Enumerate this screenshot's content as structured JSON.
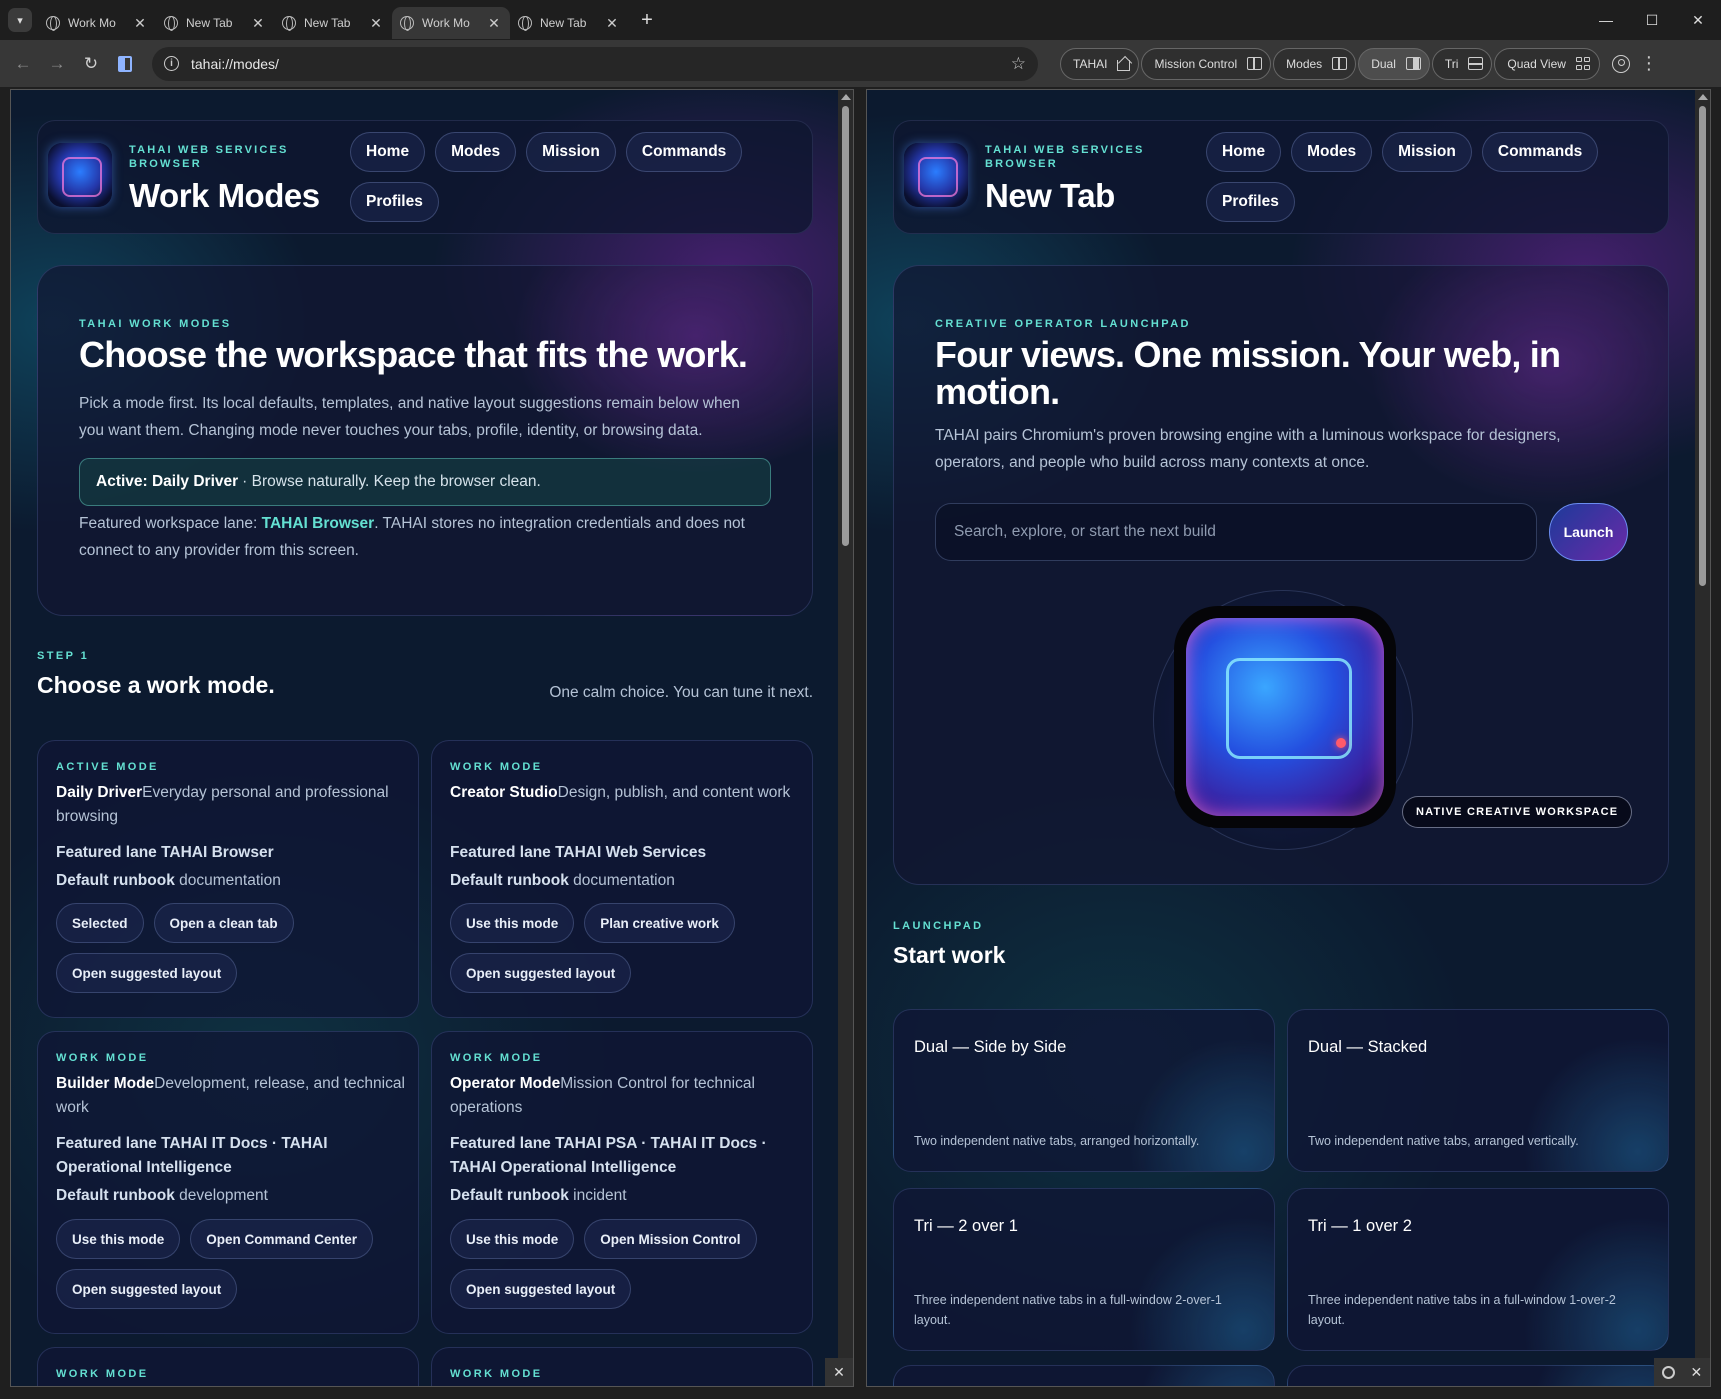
{
  "browser": {
    "tabs": [
      {
        "title": "Work Mo",
        "active": false
      },
      {
        "title": "New Tab",
        "active": false
      },
      {
        "title": "New Tab",
        "active": false
      },
      {
        "title": "Work Mo",
        "active": true
      },
      {
        "title": "New Tab",
        "active": false
      }
    ],
    "url": "tahai://modes/",
    "view_buttons": [
      {
        "label": "TAHAI",
        "icon": "home-icon"
      },
      {
        "label": "Mission Control",
        "icon": "grid-layout-icon"
      },
      {
        "label": "Modes",
        "icon": "grid-layout-icon"
      },
      {
        "label": "Dual",
        "icon": "split-view-icon",
        "active": true
      },
      {
        "label": "Tri",
        "icon": "tri-view-icon"
      },
      {
        "label": "Quad View",
        "icon": "quad-view-icon"
      }
    ]
  },
  "header": {
    "brand_sub": "TAHAI WEB SERVICES BROWSER",
    "nav": [
      "Home",
      "Modes",
      "Mission",
      "Commands",
      "Profiles"
    ]
  },
  "left": {
    "page_title": "Work Modes",
    "hero": {
      "eyebrow": "TAHAI WORK MODES",
      "title": "Choose the workspace that fits the work.",
      "description": "Pick a mode first. Its local defaults, templates, and native layout suggestions remain below when you want them. Changing mode never touches your tabs, profile, identity, or browsing data.",
      "active_label": "Active: Daily Driver",
      "active_text": "· Browse naturally. Keep the browser clean.",
      "featured_prefix": "Featured workspace lane: ",
      "featured_lane": "TAHAI Browser",
      "featured_suffix": ". TAHAI stores no integration credentials and does not connect to any provider from this screen."
    },
    "step": {
      "eyebrow": "STEP 1",
      "title": "Choose a work mode.",
      "note": "One calm choice. You can tune it next."
    },
    "modes": [
      {
        "eyebrow": "ACTIVE MODE",
        "name": "Daily Driver",
        "desc": "Everyday personal and professional browsing",
        "lane": "Featured lane TAHAI Browser",
        "runbook_label": "Default runbook",
        "runbook": "documentation",
        "buttons": [
          "Selected",
          "Open a clean tab",
          "Open suggested layout"
        ]
      },
      {
        "eyebrow": "WORK MODE",
        "name": "Creator Studio",
        "desc": "Design, publish, and content work",
        "lane": "Featured lane TAHAI Web Services",
        "runbook_label": "Default runbook",
        "runbook": "documentation",
        "buttons": [
          "Use this mode",
          "Plan creative work",
          "Open suggested layout"
        ]
      },
      {
        "eyebrow": "WORK MODE",
        "name": "Builder Mode",
        "desc": "Development, release, and technical work",
        "lane": "Featured lane TAHAI IT Docs · TAHAI Operational Intelligence",
        "runbook_label": "Default runbook",
        "runbook": "development",
        "buttons": [
          "Use this mode",
          "Open Command Center",
          "Open suggested layout"
        ]
      },
      {
        "eyebrow": "WORK MODE",
        "name": "Operator Mode",
        "desc": "Mission Control for technical operations",
        "lane": "Featured lane TAHAI PSA · TAHAI IT Docs · TAHAI Operational Intelligence",
        "runbook_label": "Default runbook",
        "runbook": "incident",
        "buttons": [
          "Use this mode",
          "Open Mission Control",
          "Open suggested layout"
        ]
      },
      {
        "eyebrow": "WORK MODE"
      },
      {
        "eyebrow": "WORK MODE"
      }
    ]
  },
  "right": {
    "page_title": "New Tab",
    "hero": {
      "eyebrow": "CREATIVE OPERATOR LAUNCHPAD",
      "title": "Four views. One mission. Your web, in motion.",
      "description": "TAHAI pairs Chromium's proven browsing engine with a luminous workspace for designers, operators, and people who build across many contexts at once.",
      "search_placeholder": "Search, explore, or start the next build",
      "launch_label": "Launch",
      "badge": "NATIVE CREATIVE WORKSPACE"
    },
    "launchpad": {
      "eyebrow": "LAUNCHPAD",
      "title": "Start work",
      "cards": [
        {
          "title": "Dual — Side by Side",
          "desc": "Two independent native tabs, arranged horizontally."
        },
        {
          "title": "Dual — Stacked",
          "desc": "Two independent native tabs, arranged vertically."
        },
        {
          "title": "Tri — 2 over 1",
          "desc": "Three independent native tabs in a full-window 2-over-1 layout."
        },
        {
          "title": "Tri — 1 over 2",
          "desc": "Three independent native tabs in a full-window 1-over-2 layout."
        }
      ]
    }
  },
  "colors": {
    "accent_teal": "#64e0d2",
    "background": "#0c1a2f",
    "chrome": "#373737"
  }
}
